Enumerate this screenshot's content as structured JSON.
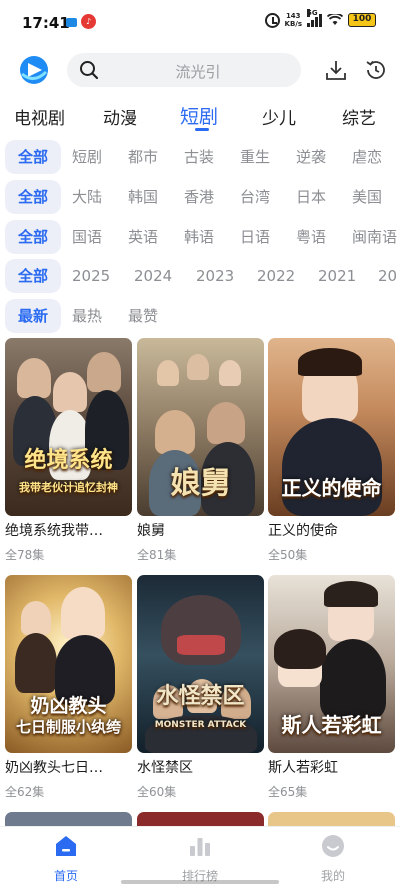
{
  "status_bar": {
    "time": "17:41",
    "net_speed_value": "143",
    "net_speed_unit": "KB/s",
    "network": "5G",
    "battery": "100"
  },
  "search": {
    "placeholder": "流光引"
  },
  "tabs": [
    {
      "label": "电视剧",
      "active": false
    },
    {
      "label": "动漫",
      "active": false
    },
    {
      "label": "短剧",
      "active": true
    },
    {
      "label": "少儿",
      "active": false
    },
    {
      "label": "综艺",
      "active": false
    }
  ],
  "filters": {
    "genre": [
      "全部",
      "短剧",
      "都市",
      "古装",
      "重生",
      "逆袭",
      "虐恋"
    ],
    "region": [
      "全部",
      "大陆",
      "韩国",
      "香港",
      "台湾",
      "日本",
      "美国"
    ],
    "language": [
      "全部",
      "国语",
      "英语",
      "韩语",
      "日语",
      "粤语",
      "闽南语"
    ],
    "year": [
      "全部",
      "2025",
      "2024",
      "2023",
      "2022",
      "2021",
      "20"
    ],
    "sort": [
      "最新",
      "最热",
      "最赞"
    ]
  },
  "cards": [
    {
      "title": "绝境系统我带…",
      "episodes": "全78集",
      "poster_text": "绝境系统",
      "poster_subtext": "我带老伙计追忆封神"
    },
    {
      "title": "娘舅",
      "episodes": "全81集",
      "poster_text": "娘舅",
      "poster_subtext": ""
    },
    {
      "title": "正义的使命",
      "episodes": "全50集",
      "poster_text": "正义的使命",
      "poster_subtext": ""
    },
    {
      "title": "奶凶教头七日…",
      "episodes": "全62集",
      "poster_text": "奶凶教头",
      "poster_subtext": "七日制服小纨绔"
    },
    {
      "title": "水怪禁区",
      "episodes": "全60集",
      "poster_text": "水怪禁区",
      "poster_subtext": "MONSTER ATTACK"
    },
    {
      "title": "斯人若彩虹",
      "episodes": "全65集",
      "poster_text": "斯人若彩虹",
      "poster_subtext": ""
    }
  ],
  "bottom_nav": [
    {
      "label": "首页",
      "active": true
    },
    {
      "label": "排行榜",
      "active": false
    },
    {
      "label": "我的",
      "active": false
    }
  ],
  "colors": {
    "accent": "#2a6bf2",
    "chip_bg": "#eceff8",
    "muted_text": "#8c8e93"
  }
}
